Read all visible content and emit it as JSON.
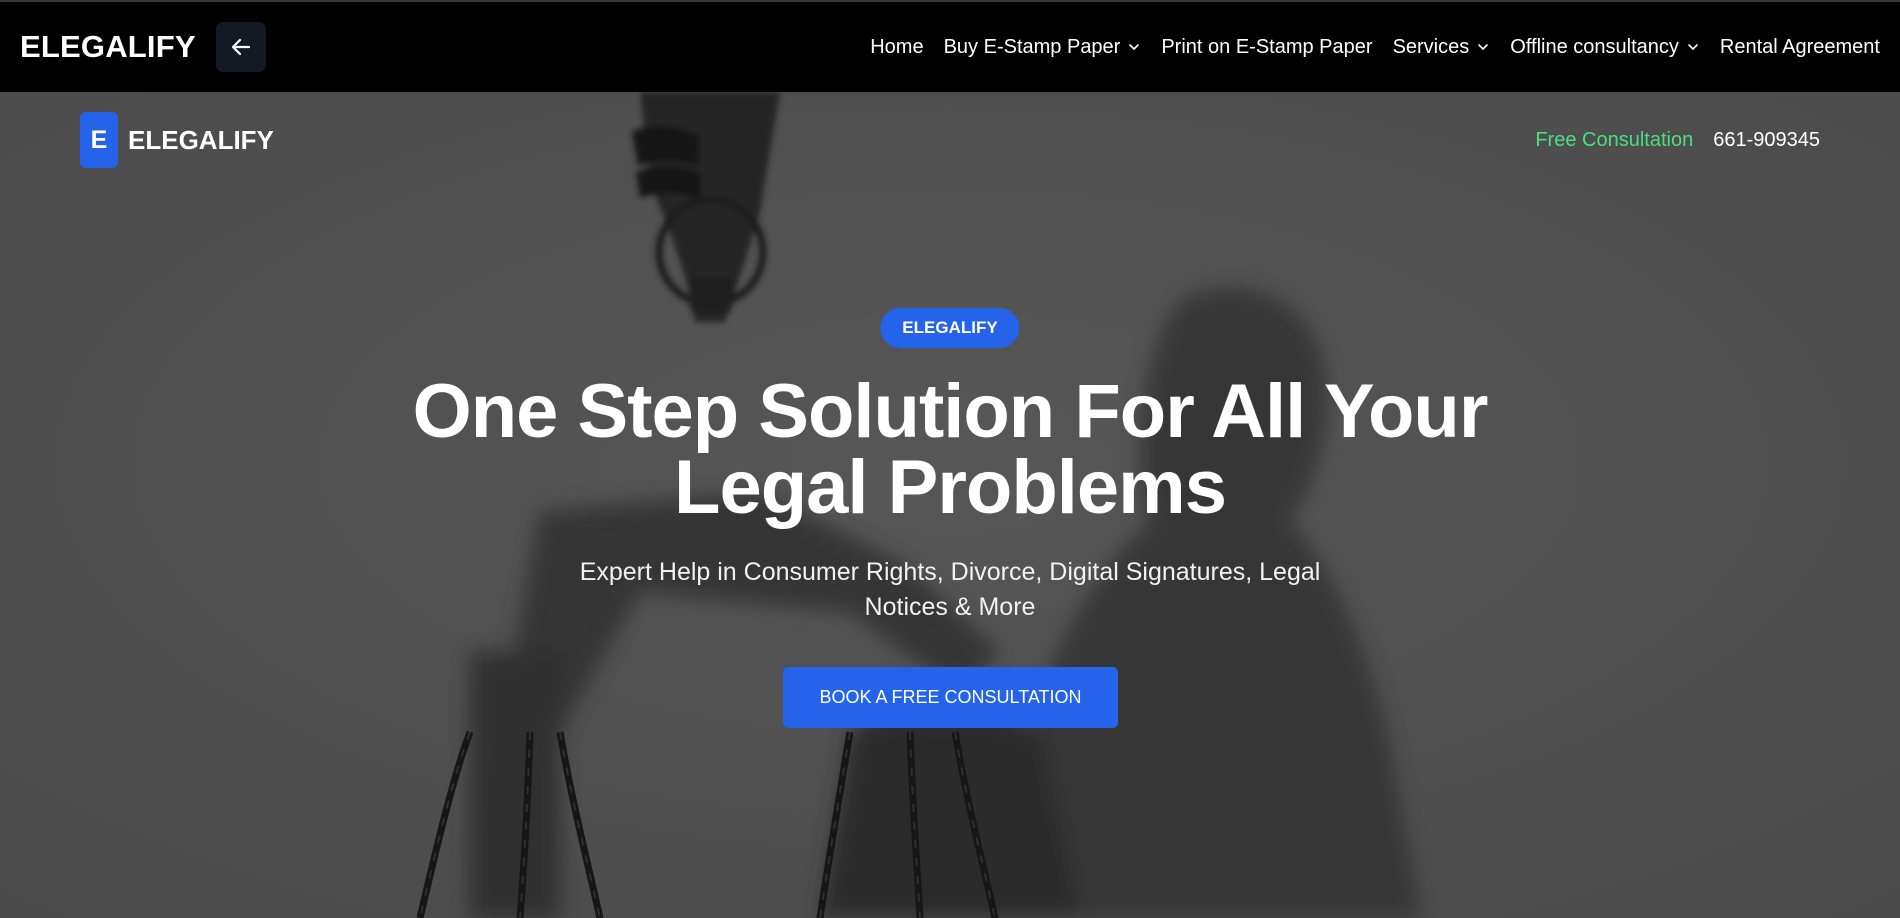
{
  "topbar": {
    "brand": "ELEGALIFY",
    "back_icon": "arrow-left-icon",
    "nav": [
      {
        "label": "Home",
        "has_dropdown": false
      },
      {
        "label": "Buy E-Stamp Paper",
        "has_dropdown": true
      },
      {
        "label": "Print on E-Stamp Paper",
        "has_dropdown": false
      },
      {
        "label": "Services",
        "has_dropdown": true
      },
      {
        "label": "Offline consultancy",
        "has_dropdown": true
      },
      {
        "label": "Rental Agreement",
        "has_dropdown": false
      }
    ]
  },
  "hero": {
    "logo_letter": "E",
    "logo_text": "ELEGALIFY",
    "free_consultation": "Free Consultation",
    "phone": "661-909345",
    "badge": "ELEGALIFY",
    "headline": "One Step Solution For All Your Legal Problems",
    "subtitle": "Expert Help in Consumer Rights, Divorce, Digital Signatures, Legal Notices & More",
    "cta_label": "BOOK A FREE CONSULTATION",
    "background": "grayscale-lady-justice-statue-photo"
  },
  "colors": {
    "accent": "#2563eb",
    "highlight_green": "#4ade80",
    "nav_bg": "#000000"
  }
}
